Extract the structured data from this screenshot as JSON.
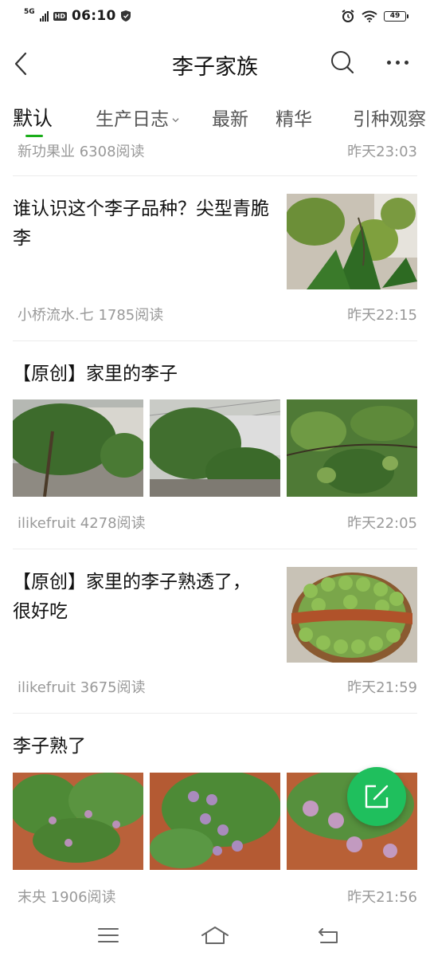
{
  "status": {
    "network": "5G",
    "hd": "HD",
    "time": "06:10",
    "battery": "49"
  },
  "header": {
    "title": "李子家族",
    "back_icon": "back-arrow-icon",
    "search_icon": "search-icon",
    "more_icon": "more-dots-icon"
  },
  "tabs": [
    {
      "label": "默认",
      "active": true
    },
    {
      "label": "生产日志",
      "dropdown": true
    },
    {
      "label": "最新"
    },
    {
      "label": "精华"
    },
    {
      "label": "引种观察"
    }
  ],
  "posts": [
    {
      "author_reads": "新功果业 6308阅读",
      "time": "昨天23:03"
    },
    {
      "title": "谁认识这个李子品种？尖型青脆李",
      "author_reads": "小桥流水.七 1785阅读",
      "time": "昨天22:15",
      "images": [
        "green-plum-on-branch"
      ]
    },
    {
      "title": "【原创】家里的李子",
      "author_reads": "ilikefruit 4278阅读",
      "time": "昨天22:05",
      "images": [
        "plum-tree-yard",
        "plum-tree-greenhouse",
        "green-plums-leaves"
      ]
    },
    {
      "title": "【原创】家里的李子熟透了，很好吃",
      "author_reads": "ilikefruit 3675阅读",
      "time": "昨天21:59",
      "images": [
        "basket-of-green-plums"
      ]
    },
    {
      "title": "李子熟了",
      "author_reads": "末央 1906阅读",
      "time": "昨天21:56",
      "images": [
        "plum-orchard-red-soil",
        "purple-plums-branch",
        "purple-plums-closeup"
      ]
    }
  ],
  "fab": {
    "icon": "edit-icon"
  },
  "nav": {
    "menu_icon": "menu-icon",
    "home_icon": "home-icon",
    "back_icon": "return-icon"
  },
  "colors": {
    "accent": "#1aad19",
    "fab": "#1fbf5d"
  }
}
